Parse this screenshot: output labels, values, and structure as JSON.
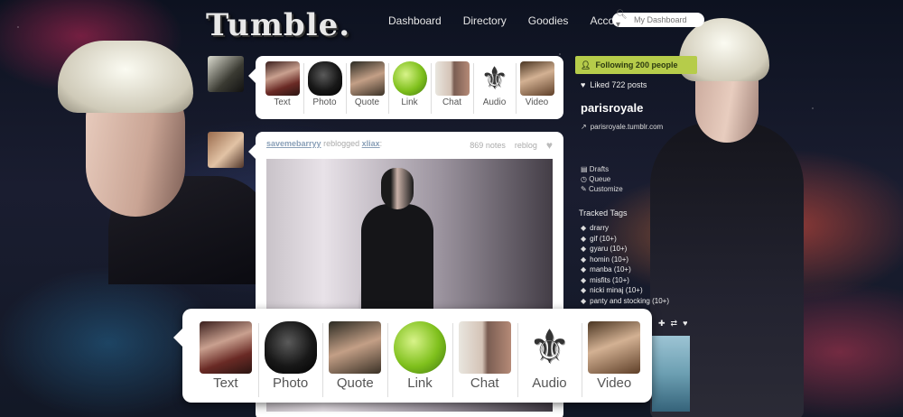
{
  "header": {
    "logo": "Tumble.",
    "nav": [
      "Dashboard",
      "Directory",
      "Goodies",
      "Account"
    ],
    "search_placeholder": "My Dashboard"
  },
  "post_types": [
    {
      "label": "Text",
      "icon": "text-thumb-icon"
    },
    {
      "label": "Photo",
      "icon": "skull-icon"
    },
    {
      "label": "Quote",
      "icon": "quote-thumb-icon"
    },
    {
      "label": "Link",
      "icon": "apple-icon"
    },
    {
      "label": "Chat",
      "icon": "chat-thumb-icon"
    },
    {
      "label": "Audio",
      "icon": "fleur-de-lis-icon"
    },
    {
      "label": "Video",
      "icon": "video-thumb-icon"
    }
  ],
  "post": {
    "user": "savemebarryy",
    "action": "reblogged",
    "source": "xliax",
    "notes": "869 notes",
    "reblog": "reblog"
  },
  "sidebar": {
    "following": "Following 200 people",
    "liked": "Liked 722 posts",
    "blog_name": "parisroyale",
    "blog_url": "parisroyale.tumblr.com",
    "links": [
      "Drafts",
      "Queue",
      "Customize"
    ],
    "tracked_title": "Tracked Tags",
    "tags": [
      "drarry",
      "gif (10+)",
      "gyaru (10+)",
      "homin (10+)",
      "manba (10+)",
      "misfits (10+)",
      "nicki minaj (10+)",
      "panty and stocking (10+)"
    ]
  },
  "colors": {
    "follow_bg": "#b6cc4a",
    "link_blue": "#8aa0b8"
  }
}
